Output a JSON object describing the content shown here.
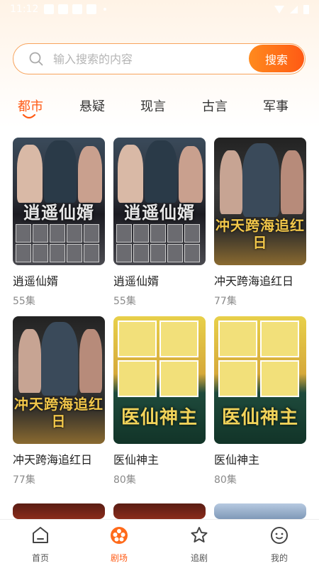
{
  "status_bar": {
    "time": "11:12"
  },
  "search": {
    "placeholder": "输入搜索的内容",
    "button_label": "搜索"
  },
  "categories": [
    "都市",
    "悬疑",
    "现言",
    "古言",
    "军事"
  ],
  "active_category": "都市",
  "dramas": [
    {
      "title": "逍遥仙婿",
      "episodes": "55集",
      "poster_text": "逍遥仙婿"
    },
    {
      "title": "逍遥仙婿",
      "episodes": "55集",
      "poster_text": "逍遥仙婿"
    },
    {
      "title": "冲天跨海追红日",
      "episodes": "77集",
      "poster_text": "冲天跨海追红日"
    },
    {
      "title": "冲天跨海追红日",
      "episodes": "77集",
      "poster_text": "冲天跨海追红日"
    },
    {
      "title": "医仙神主",
      "episodes": "80集",
      "poster_text": "医仙神主"
    },
    {
      "title": "医仙神主",
      "episodes": "80集",
      "poster_text": "医仙神主"
    }
  ],
  "bottom_nav": [
    {
      "label": "首页",
      "icon": "home-icon"
    },
    {
      "label": "剧场",
      "icon": "theater-icon"
    },
    {
      "label": "追剧",
      "icon": "star-icon"
    },
    {
      "label": "我的",
      "icon": "profile-icon"
    }
  ],
  "colors": {
    "accent": "#ff5a14",
    "accent_light": "#ff8a1e"
  }
}
